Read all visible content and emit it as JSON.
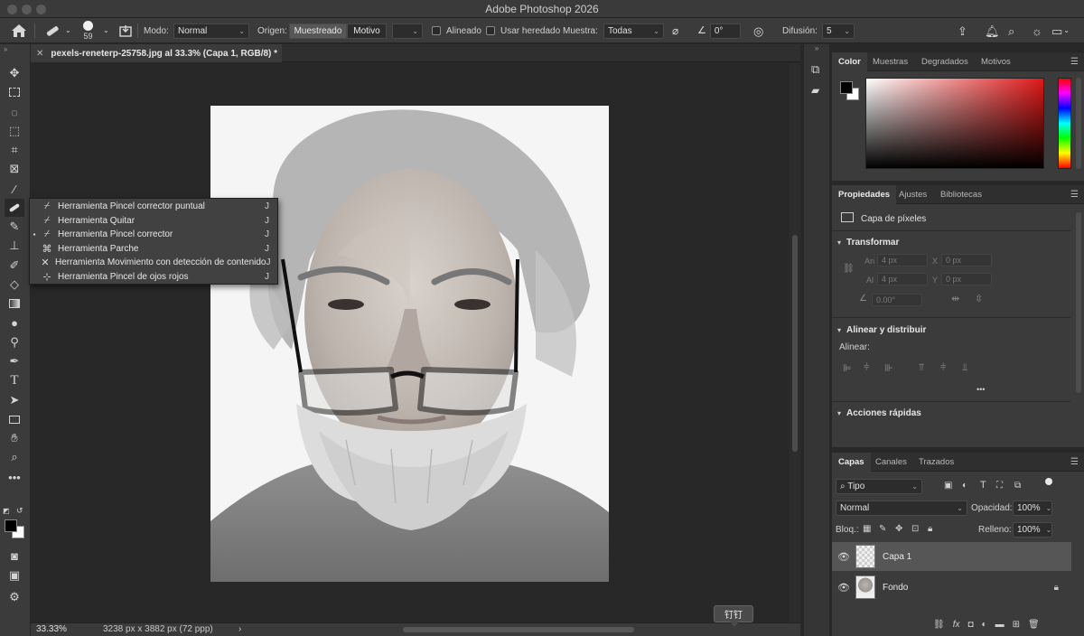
{
  "app": {
    "title": "Adobe Photoshop 2026"
  },
  "options": {
    "brush_size": "59",
    "mode_label": "Modo:",
    "mode_value": "Normal",
    "origin_label": "Origen:",
    "origin_sampled": "Muestreado",
    "origin_pattern": "Motivo",
    "aligned_label": "Alineado",
    "use_legacy_label": "Usar heredado",
    "sample_label": "Muestra:",
    "sample_value": "Todas",
    "angle_value": "0°",
    "diffusion_label": "Difusión:",
    "diffusion_value": "5"
  },
  "document": {
    "tab_title": "pexels-reneterp-25758.jpg al 33.3% (Capa 1, RGB/8) *",
    "zoom": "33.33%",
    "dimensions": "3238 px x 3882 px (72 ppp)"
  },
  "flyout": {
    "items": [
      {
        "label": "Herramienta Pincel corrector puntual",
        "shortcut": "J",
        "selected": ""
      },
      {
        "label": "Herramienta Quitar",
        "shortcut": "J",
        "selected": ""
      },
      {
        "label": "Herramienta Pincel corrector",
        "shortcut": "J",
        "selected": "▪"
      },
      {
        "label": "Herramienta Parche",
        "shortcut": "J",
        "selected": ""
      },
      {
        "label": "Herramienta Movimiento con detección de contenido",
        "shortcut": "J",
        "selected": ""
      },
      {
        "label": "Herramienta Pincel de ojos rojos",
        "shortcut": "J",
        "selected": ""
      }
    ]
  },
  "tooltip": {
    "text": "钉钉"
  },
  "color_panel": {
    "tabs": [
      "Color",
      "Muestras",
      "Degradados",
      "Motivos"
    ],
    "hue_color": "#e01818"
  },
  "properties_panel": {
    "tabs": [
      "Propiedades",
      "Ajustes",
      "Bibliotecas"
    ],
    "pixel_layer": "Capa de píxeles",
    "transform_title": "Transformar",
    "an_label": "An",
    "an_value": "4 px",
    "x_label": "X",
    "x_value": "0 px",
    "al_label": "Al",
    "al_value": "4 px",
    "y_label": "Y",
    "y_value": "0 px",
    "angle_value": "0.00°",
    "align_title": "Alinear y distribuir",
    "align_label": "Alinear:",
    "more": "•••",
    "quick_actions_title": "Acciones rápidas"
  },
  "layers_panel": {
    "tabs": [
      "Capas",
      "Canales",
      "Trazados"
    ],
    "filter_value": "Tipo",
    "blend_mode": "Normal",
    "opacity_label": "Opacidad:",
    "opacity_value": "100%",
    "lock_label": "Bloq.:",
    "fill_label": "Relleno:",
    "fill_value": "100%",
    "layers": [
      {
        "name": "Capa 1"
      },
      {
        "name": "Fondo"
      }
    ]
  }
}
